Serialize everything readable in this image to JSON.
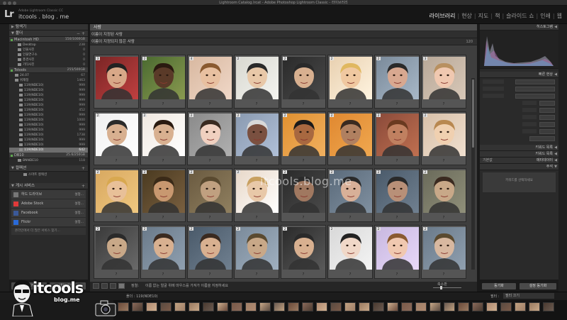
{
  "window": {
    "title": "Lightroom Catalog.lrcat - Adobe Photoshop Lightroom Classic - 라이브러리"
  },
  "identity": {
    "logo": "Lr",
    "line1": "Adobe Lightroom Classic CC",
    "line2": "itcools . blog . me"
  },
  "modules": [
    {
      "label": "라이브러리",
      "active": true
    },
    {
      "label": "현상"
    },
    {
      "label": "지도"
    },
    {
      "label": "책"
    },
    {
      "label": "슬라이드 쇼"
    },
    {
      "label": "인쇄"
    },
    {
      "label": "웹"
    }
  ],
  "left_panel": {
    "navigator": "탐색기",
    "folders": "폴더",
    "volume1": {
      "name": "Macintosh HD",
      "count": "150/1000GB"
    },
    "vol1_folders": [
      {
        "name": "Desktop",
        "count": "238"
      },
      {
        "name": "인물사진",
        "count": "0"
      },
      {
        "name": "인물연구소",
        "count": "0"
      },
      {
        "name": "풍경사진",
        "count": "0"
      },
      {
        "name": "기타사진",
        "count": "0"
      }
    ],
    "volume2": {
      "name": "Tstools",
      "count": "255/500GB"
    },
    "vol2_folders": [
      {
        "name": "24.07",
        "count": "67"
      },
      {
        "name": "위재정",
        "count": "1463"
      },
      {
        "name": "119(NDE10)",
        "count": "999"
      },
      {
        "name": "119(NDE10)",
        "count": "999"
      },
      {
        "name": "119(NDE10)",
        "count": "999"
      },
      {
        "name": "119(NDE10)",
        "count": "999"
      },
      {
        "name": "119(NDE10)",
        "count": "999"
      },
      {
        "name": "119(NDE10)",
        "count": "452"
      },
      {
        "name": "119(NDE10)",
        "count": "999"
      },
      {
        "name": "119(NDE10)",
        "count": "1000"
      },
      {
        "name": "119(NDE10)",
        "count": "999"
      },
      {
        "name": "119(NDE10)",
        "count": "999"
      },
      {
        "name": "119(NDE10)",
        "count": "1738"
      },
      {
        "name": "119(NDE10)",
        "count": "999"
      },
      {
        "name": "119(NDE10)",
        "count": "999"
      },
      {
        "name": "119(NDE10)",
        "count": "642"
      }
    ],
    "volume3": {
      "name": "DB10",
      "count": "25.6/250GB"
    },
    "vol3_folder": {
      "name": "BNNDE10",
      "count": "118"
    },
    "collections": "컬렉션",
    "smart_collection": "스마트 컬렉션",
    "publish": "게시 서비스",
    "services": [
      {
        "name": "하드 드라이브",
        "btn": "설정..."
      },
      {
        "name": "Adobe Stock",
        "btn": "설정..."
      },
      {
        "name": "Facebook",
        "btn": "설정..."
      },
      {
        "name": "Flickr",
        "btn": "설정..."
      }
    ],
    "find_more": "온라인에서 더 많은 서비스 찾기...",
    "import_btn": "가져오기...",
    "export_btn": "내보내기..."
  },
  "center": {
    "title": "사람",
    "named": "이름이 지정된 사람",
    "unnamed": "이름이 지정되지 않은 사람",
    "unnamed_count": "120",
    "question_mark": "?",
    "watermark": "itcools.blog.me"
  },
  "grid_numbers": [
    "3",
    "2",
    "4",
    "2",
    "2",
    "2",
    "2",
    "3",
    "2",
    "2",
    "2",
    "2",
    "2",
    "2",
    "2",
    "2",
    "2",
    "2",
    "2",
    "2",
    "2",
    "2",
    "2",
    "2",
    "2",
    "2",
    "2",
    "2",
    "2",
    "2",
    "2",
    "2"
  ],
  "toolbar": {
    "sort": "정렬:",
    "hint": "이름 없는 얼굴 위에 마우스를 가져가 이름을 지정하세요",
    "thumb_label": "축소판"
  },
  "right_panel": {
    "histogram": "히스토그램",
    "quick_develop": "빠른 현상",
    "keywording": "키워드 목록",
    "keyword_list": "키워드 목록",
    "metadata": "메타데이터",
    "comments": "주석",
    "keyword_box": "키워드를 선택하세요",
    "sync_btn": "동기화",
    "sync_settings_btn": "설정 동기화"
  },
  "filmstrip": {
    "source": "폴더 : 119(NDE10)",
    "filter": "필터 :",
    "filter_value": "필터 끄기"
  },
  "branding": {
    "title": "itcools",
    "subtitle": "blog.me"
  }
}
